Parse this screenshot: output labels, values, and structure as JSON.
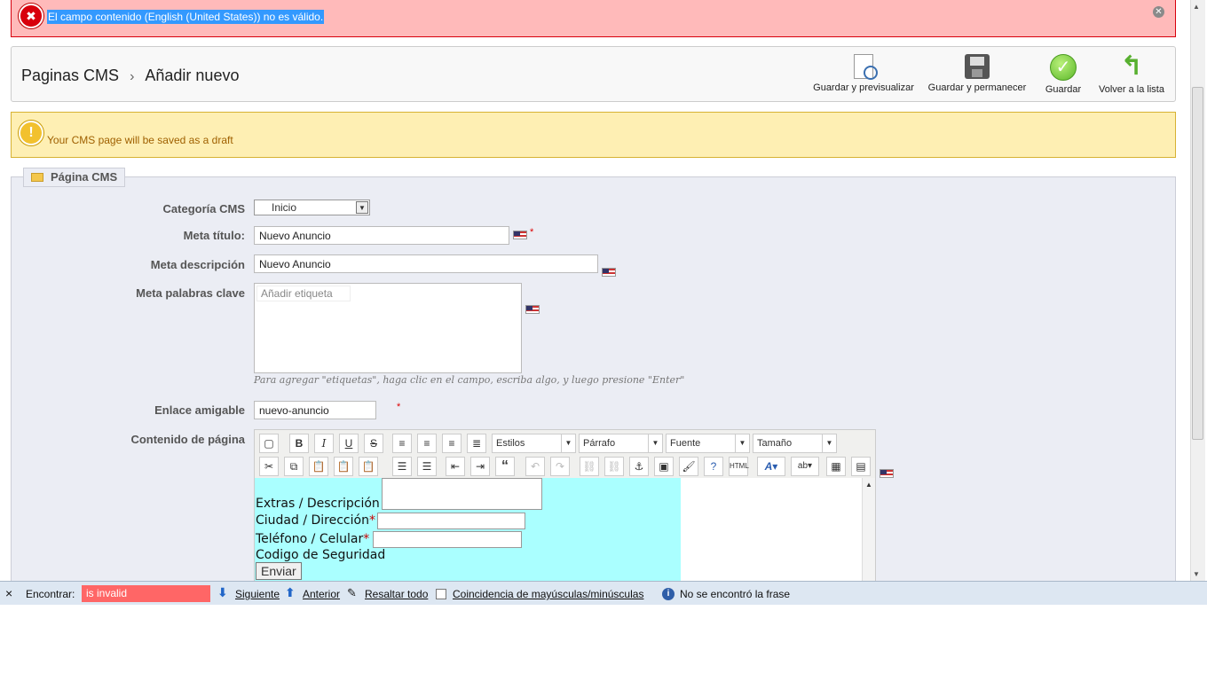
{
  "error": {
    "message": "El campo contenido (English (United States)) no es válido."
  },
  "breadcrumb": {
    "parent": "Paginas CMS",
    "current": "Añadir nuevo"
  },
  "toolbar": {
    "preview_label": "Guardar y previsualizar",
    "save_stay_label": "Guardar y permanecer",
    "save_label": "Guardar",
    "back_label": "Volver a la lista"
  },
  "warning": {
    "message": "Your CMS page will be saved as a draft"
  },
  "fieldset": {
    "legend": "Página CMS"
  },
  "form": {
    "category_label": "Categoría CMS",
    "category_value": "Inicio",
    "meta_title_label": "Meta título:",
    "meta_title_value": "Nuevo Anuncio",
    "meta_desc_label": "Meta descripción",
    "meta_desc_value": "Nuevo Anuncio",
    "meta_keywords_label": "Meta palabras clave",
    "tags_placeholder": "Añadir etiqueta",
    "tags_hint": "Para agregar \"etiquetas\", haga clic en el campo, escriba algo, y luego presione \"Enter\"",
    "friendly_url_label": "Enlace amigable",
    "friendly_url_value": "nuevo-anuncio",
    "content_label": "Contenido de página",
    "required_mark": "*"
  },
  "editor": {
    "styles": "Estilos",
    "format": "Párrafo",
    "font": "Fuente",
    "size": "Tamaño",
    "content": {
      "extras": "Extras / Descripción",
      "city": "Ciudad / Dirección",
      "phone": "Teléfono / Celular",
      "code": "Codigo de Seguridad",
      "submit": "Enviar",
      "asterisk": "*"
    }
  },
  "findbar": {
    "close": "×",
    "label": "Encontrar:",
    "query": "is invalid",
    "next": "Siguiente",
    "previous": "Anterior",
    "highlight": "Resaltar todo",
    "match_case": "Coincidencia de mayúsculas/minúsculas",
    "status": "No se encontró la frase"
  }
}
